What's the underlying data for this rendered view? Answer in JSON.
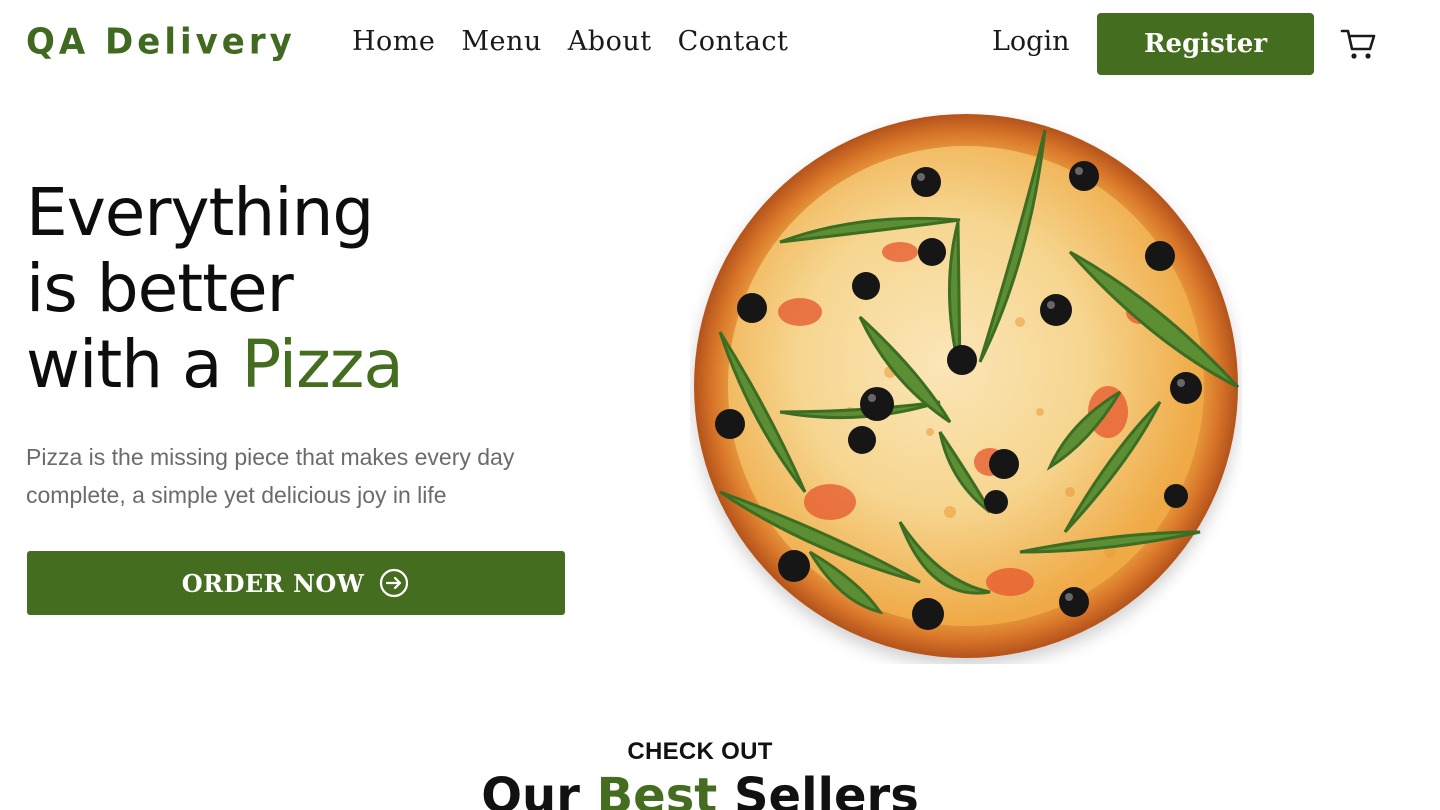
{
  "brand": {
    "logo_text": "QA Delivery",
    "accent_color": "#456d20"
  },
  "nav": {
    "links": [
      "Home",
      "Menu",
      "About",
      "Contact"
    ],
    "login_label": "Login",
    "register_label": "Register",
    "cart_icon": "cart-icon"
  },
  "hero": {
    "title_line1": "Everything",
    "title_line2": "is better",
    "title_line3_prefix": "with a ",
    "title_line3_accent": "Pizza",
    "subtitle": "Pizza is the missing piece that makes every day complete, a simple yet delicious joy in life",
    "order_button_label": "ORDER NOW",
    "order_button_icon": "arrow-right-circle-icon",
    "image": "pizza-image"
  },
  "best_sellers": {
    "kicker": "CHECK OUT",
    "title_prefix": "Our ",
    "title_accent": "Best",
    "title_suffix": " Sellers"
  }
}
